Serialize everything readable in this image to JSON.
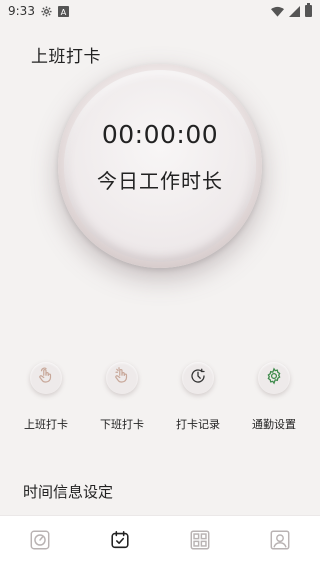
{
  "status_bar": {
    "time": "9:33",
    "icons": [
      "settings-gear-icon",
      "a-notification-icon",
      "wifi-icon",
      "signal-icon",
      "battery-icon"
    ]
  },
  "header": {
    "title": "上班打卡"
  },
  "clock": {
    "time": "00:00:00",
    "label": "今日工作时长"
  },
  "actions": [
    {
      "label": "上班打卡",
      "icon": "tap-hand-icon"
    },
    {
      "label": "下班打卡",
      "icon": "tap-hand-alt-icon"
    },
    {
      "label": "打卡记录",
      "icon": "history-clock-icon"
    },
    {
      "label": "通勤设置",
      "icon": "settings-gear-icon"
    }
  ],
  "section": {
    "title": "时间信息设定"
  },
  "bottom_nav": {
    "items": [
      {
        "icon": "clock-tab-icon",
        "active": false
      },
      {
        "icon": "calendar-check-tab-icon",
        "active": true
      },
      {
        "icon": "grid-tab-icon",
        "active": false
      },
      {
        "icon": "profile-tab-icon",
        "active": false
      }
    ]
  },
  "colors": {
    "background": "#f4f2f1",
    "accent_green": "#3d8a4a",
    "icon_inactive": "#b9b3b3",
    "icon_active": "#222222"
  }
}
